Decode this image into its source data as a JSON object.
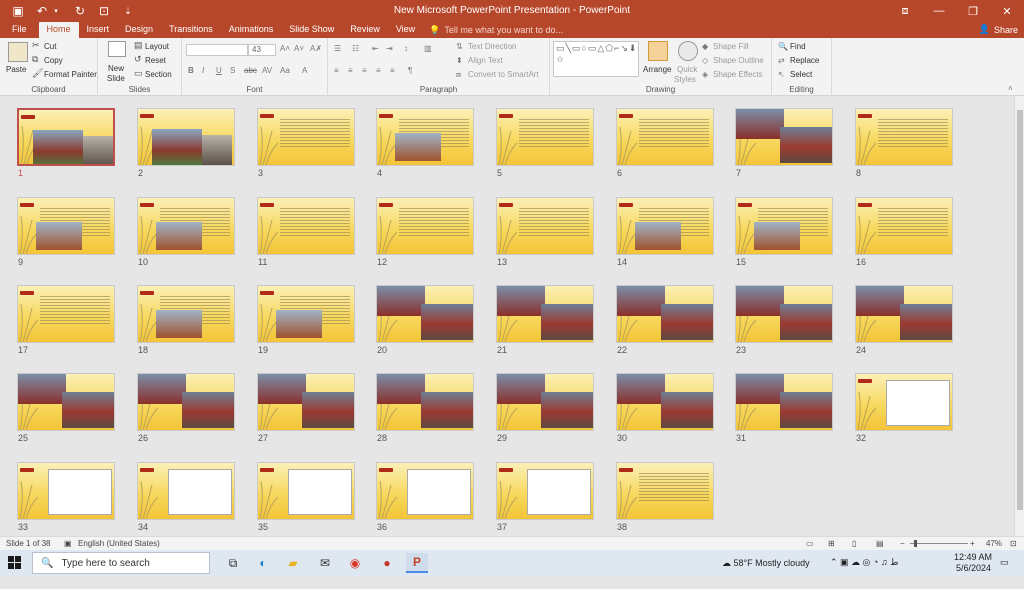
{
  "app": {
    "title": "New Microsoft PowerPoint Presentation - PowerPoint",
    "accent": "#b7472a"
  },
  "quick_access": [
    "save-icon",
    "undo-icon",
    "redo-icon",
    "present-icon",
    "customize-icon"
  ],
  "tabs": [
    "File",
    "Home",
    "Insert",
    "Design",
    "Transitions",
    "Animations",
    "Slide Show",
    "Review",
    "View"
  ],
  "active_tab": "Home",
  "tell_me": "Tell me what you want to do...",
  "share": "Share",
  "ribbon": {
    "clipboard": {
      "paste": "Paste",
      "cut": "Cut",
      "copy": "Copy",
      "format_painter": "Format Painter",
      "label": "Clipboard"
    },
    "slides": {
      "new_slide": "New",
      "new_slide2": "Slide",
      "layout": "Layout",
      "reset": "Reset",
      "section": "Section",
      "label": "Slides"
    },
    "font": {
      "font_name": "",
      "font_size": "43",
      "label": "Font"
    },
    "paragraph": {
      "text_direction": "Text Direction",
      "align_text": "Align Text",
      "convert_smartart": "Convert to SmartArt",
      "label": "Paragraph"
    },
    "drawing": {
      "arrange": "Arrange",
      "quick_styles": "Quick",
      "quick_styles2": "Styles",
      "shape_fill": "Shape Fill",
      "shape_outline": "Shape Outline",
      "shape_effects": "Shape Effects",
      "label": "Drawing"
    },
    "editing": {
      "find": "Find",
      "replace": "Replace",
      "select": "Select",
      "label": "Editing"
    }
  },
  "slides": [
    {
      "n": "1",
      "kind": "title-photo"
    },
    {
      "n": "2",
      "kind": "title-photo"
    },
    {
      "n": "3",
      "kind": "text"
    },
    {
      "n": "4",
      "kind": "text-photo"
    },
    {
      "n": "5",
      "kind": "text"
    },
    {
      "n": "6",
      "kind": "text"
    },
    {
      "n": "7",
      "kind": "photos"
    },
    {
      "n": "8",
      "kind": "text"
    },
    {
      "n": "9",
      "kind": "text-photo"
    },
    {
      "n": "10",
      "kind": "text-photo"
    },
    {
      "n": "11",
      "kind": "text"
    },
    {
      "n": "12",
      "kind": "text"
    },
    {
      "n": "13",
      "kind": "text"
    },
    {
      "n": "14",
      "kind": "text-photo"
    },
    {
      "n": "15",
      "kind": "text-photo"
    },
    {
      "n": "16",
      "kind": "text"
    },
    {
      "n": "17",
      "kind": "text"
    },
    {
      "n": "18",
      "kind": "text-photo"
    },
    {
      "n": "19",
      "kind": "text-photo"
    },
    {
      "n": "20",
      "kind": "photos"
    },
    {
      "n": "21",
      "kind": "photos"
    },
    {
      "n": "22",
      "kind": "photos"
    },
    {
      "n": "23",
      "kind": "photos"
    },
    {
      "n": "24",
      "kind": "photos"
    },
    {
      "n": "25",
      "kind": "photos"
    },
    {
      "n": "26",
      "kind": "photos"
    },
    {
      "n": "27",
      "kind": "photos"
    },
    {
      "n": "28",
      "kind": "photos"
    },
    {
      "n": "29",
      "kind": "photos"
    },
    {
      "n": "30",
      "kind": "photos"
    },
    {
      "n": "31",
      "kind": "photos"
    },
    {
      "n": "32",
      "kind": "drawing"
    },
    {
      "n": "33",
      "kind": "drawing"
    },
    {
      "n": "34",
      "kind": "drawing"
    },
    {
      "n": "35",
      "kind": "drawing"
    },
    {
      "n": "36",
      "kind": "drawing"
    },
    {
      "n": "37",
      "kind": "drawing"
    },
    {
      "n": "38",
      "kind": "text"
    }
  ],
  "selected_slide": "1",
  "status": {
    "slide_of": "Slide 1 of 38",
    "language": "English (United States)",
    "zoom": "47%"
  },
  "taskbar": {
    "search_placeholder": "Type here to search",
    "weather": "58°F  Mostly cloudy",
    "time": "12:49 AM",
    "date": "5/6/2024"
  }
}
